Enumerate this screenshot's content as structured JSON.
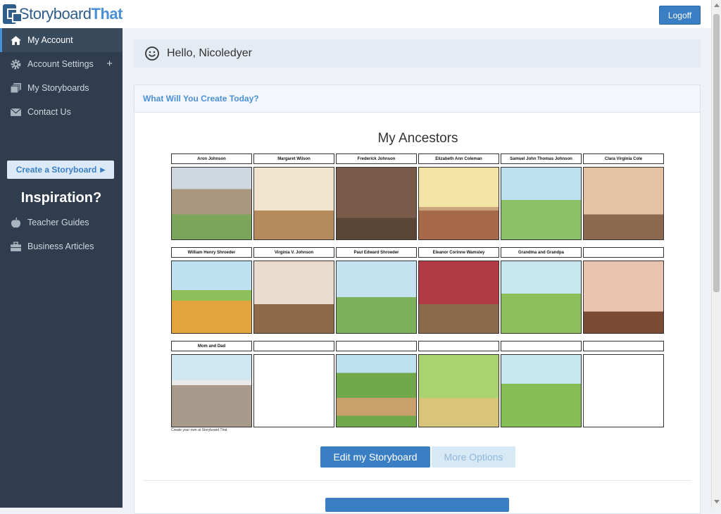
{
  "logo": {
    "part1": "Storyboard",
    "part2": "That"
  },
  "sidebar": {
    "items": [
      {
        "label": "My Account",
        "icon": "home-icon"
      },
      {
        "label": "Account Settings",
        "icon": "gear-icon"
      },
      {
        "label": "My Storyboards",
        "icon": "storyboards-icon"
      },
      {
        "label": "Contact Us",
        "icon": "envelope-icon"
      }
    ],
    "create_label": "Create a Storyboard",
    "inspiration": "Inspiration?",
    "links": [
      {
        "label": "Teacher Guides",
        "icon": "apple-icon"
      },
      {
        "label": "Business Articles",
        "icon": "briefcase-icon"
      }
    ]
  },
  "header": {
    "logoff": "Logoff"
  },
  "greeting": "Hello, Nicoledyer",
  "panel": {
    "heading": "What Will You Create Today?"
  },
  "storyboard": {
    "title": "My Ancestors",
    "cells": [
      {
        "title": "Aron Johnson",
        "scene": "house"
      },
      {
        "title": "Margaret Wilson",
        "scene": "parlor"
      },
      {
        "title": "Frederick Johnson",
        "scene": "brick"
      },
      {
        "title": "Elizabeth Ann Coleman",
        "scene": "room"
      },
      {
        "title": "Samuel John Thomas Johnson",
        "scene": "farm"
      },
      {
        "title": "Clara Virginia Cole",
        "scene": "fireplace"
      },
      {
        "title": "William Henry Shroeder",
        "scene": "field"
      },
      {
        "title": "Virginia V. Johnson",
        "scene": "dining"
      },
      {
        "title": "Paul Edward Shroeder",
        "scene": "redhouse"
      },
      {
        "title": "Eleanor Corinne Wamsley",
        "scene": "sofa"
      },
      {
        "title": "Grandma and Grandpa",
        "scene": "tree"
      },
      {
        "title": "",
        "scene": "window"
      },
      {
        "title": "Mom and Dad",
        "scene": "patio"
      },
      {
        "title": "",
        "scene": "blank"
      },
      {
        "title": "",
        "scene": "baseball"
      },
      {
        "title": "",
        "scene": "classroom"
      },
      {
        "title": "",
        "scene": "playground"
      },
      {
        "title": "",
        "scene": "blank"
      }
    ],
    "credit": "Create your own at Storyboard That"
  },
  "buttons": {
    "edit": "Edit my Storyboard",
    "more": "More Options"
  }
}
